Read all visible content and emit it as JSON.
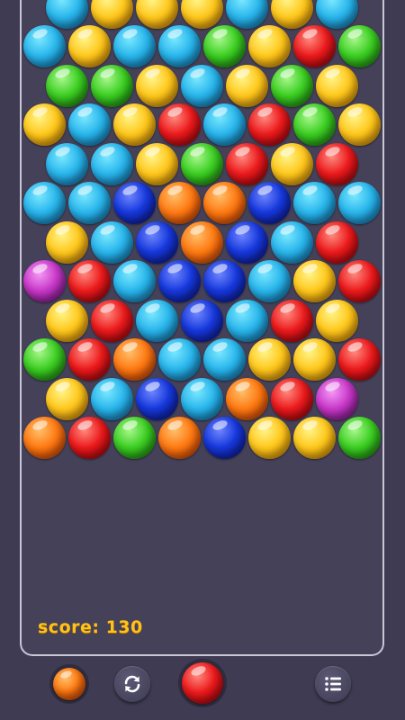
{
  "score": {
    "text": "score: 130"
  },
  "colors": {
    "blue": "#29b6ec",
    "yellow": "#ffc81c",
    "green": "#3ccf22",
    "red": "#ec1a1c",
    "navy": "#1638dc",
    "orange": "#ff7a12",
    "purple": "#c838c8",
    "background": "#3f3b53",
    "board_border": "#c9c6d6",
    "score_text": "#ffc21a"
  },
  "grid": {
    "rows": [
      [
        "blue",
        "yellow",
        "yellow",
        "yellow",
        "blue",
        "yellow",
        "blue"
      ],
      [
        "blue",
        "yellow",
        "blue",
        "blue",
        "green",
        "yellow",
        "red",
        "green"
      ],
      [
        "green",
        "green",
        "yellow",
        "blue",
        "yellow",
        "green",
        "yellow"
      ],
      [
        "yellow",
        "blue",
        "yellow",
        "red",
        "blue",
        "red",
        "green",
        "yellow"
      ],
      [
        "blue",
        "blue",
        "yellow",
        "green",
        "red",
        "yellow",
        "red"
      ],
      [
        "blue",
        "blue",
        "navy",
        "orange",
        "orange",
        "navy",
        "blue",
        "blue"
      ],
      [
        "yellow",
        "blue",
        "navy",
        "orange",
        "navy",
        "blue",
        "red"
      ],
      [
        "purple",
        "red",
        "blue",
        "navy",
        "navy",
        "blue",
        "yellow",
        "red"
      ],
      [
        "yellow",
        "red",
        "blue",
        "navy",
        "blue",
        "red",
        "yellow"
      ],
      [
        "green",
        "red",
        "orange",
        "blue",
        "blue",
        "yellow",
        "yellow",
        "red"
      ],
      [
        "yellow",
        "blue",
        "navy",
        "blue",
        "orange",
        "red",
        "purple"
      ],
      [
        "orange",
        "red",
        "green",
        "orange",
        "navy",
        "yellow",
        "yellow",
        "green"
      ]
    ]
  },
  "next_bubble": {
    "color": "orange"
  },
  "current_bubble": {
    "color": "red"
  },
  "icons": {
    "swap": "swap-arrows-icon",
    "menu": "list-menu-icon"
  }
}
